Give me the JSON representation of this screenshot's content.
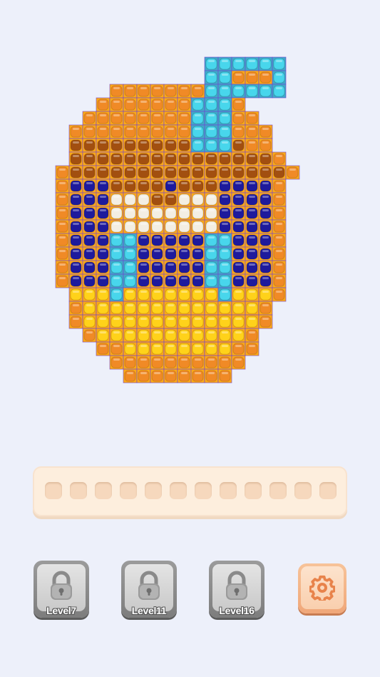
{
  "colors": {
    "background": "#edf0fa",
    "orange": "#f08a26",
    "brown": "#a24f10",
    "navy": "#1e1a9c",
    "cyan": "#48d6ec",
    "yellow": "#ffd21a",
    "cream": "#f3eee3",
    "gold": "#fba818",
    "border": "#7245d0"
  },
  "pixel_art": {
    "description_rows": [
      "...........CCCCCC",
      "...........CCOOOC",
      "....OOOOOOOCCCCCC",
      "...OOOOOOOCCCO...",
      "..OOOOOOOOCCCOO..",
      ".OOOOOOOOOCCCOOO.",
      ".BBBBBBBBBCCCBOO.",
      ".BBBBBBBBBBBBBBBO",
      "OBBBBBBBBBBBBBBBBO",
      "ONNNBBBBNBBBNNNNO",
      "ONNNWWWBBWWWNNNNO",
      "ONNNWWWWWWWWNNNNO",
      "ONNNWWWWWWWWNNNNO",
      "ONNNCCNNNNNCCNNNO",
      "ONNNCCNNNNNCCNNNO",
      "ONNNCCNNNNNCCNNNO",
      "ONNNCCNNNNNCCNNNO",
      ".YYYCYYYYYYYCYYYO",
      ".OYYYYYYYYYYYYYO.",
      ".OYYYYYYYYYYYYYO.",
      "..OYYYYYYYYYYYO..",
      "...OOYYYYYYYYOO..",
      "....OOOOOOOOOO...",
      ".....OOOOOOOO...."
    ]
  },
  "tray": {
    "slot_count": 12
  },
  "locked_levels": [
    {
      "label": "Level7",
      "icon": "padlock-icon"
    },
    {
      "label": "Level11",
      "icon": "padlock-icon"
    },
    {
      "label": "Level16",
      "icon": "padlock-icon"
    }
  ],
  "settings": {
    "icon": "gear-icon"
  }
}
